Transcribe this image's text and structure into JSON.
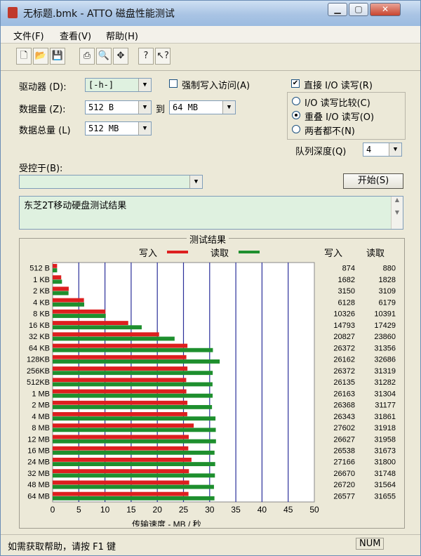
{
  "window": {
    "title": "无标题.bmk - ATTO 磁盘性能测试"
  },
  "menu": [
    "文件(F)",
    "查看(V)",
    "帮助(H)"
  ],
  "toolbar": [
    {
      "icon": "new-file-icon",
      "glyph": "🗋"
    },
    {
      "icon": "open-folder-icon",
      "glyph": "📂"
    },
    {
      "icon": "save-icon",
      "glyph": "💾"
    },
    {
      "icon": "print-icon",
      "glyph": "⎙"
    },
    {
      "icon": "print-preview-icon",
      "glyph": "🔍"
    },
    {
      "icon": "move-icon",
      "glyph": "✥"
    },
    {
      "icon": "help-icon",
      "glyph": "?"
    },
    {
      "icon": "context-help-icon",
      "glyph": "↖?"
    }
  ],
  "settings": {
    "drive_label": "驱动器 (D):",
    "drive_value": "[-h-]",
    "force_write_label": "强制写入访问(A)",
    "direct_io_label": "直接 I/O 读写(R)",
    "transfer_label": "数据量 (Z):",
    "transfer_from": "512 B",
    "to_label": "到",
    "transfer_to": "64 MB",
    "total_label": "数据总量 (L)",
    "total_value": "512 MB",
    "radio_1": "I/O 读写比较(C)",
    "radio_2": "重叠 I/O 读写(O)",
    "radio_3": "两者都不(N)",
    "queue_label": "队列深度(Q)",
    "queue_value": "4",
    "controlled_label": "受控于(B):",
    "controlled_value": "",
    "start_button": "开始(S)",
    "description": "东芝2T移动硬盘测试结果"
  },
  "results": {
    "title": "测试结果",
    "legend_write": "写入",
    "legend_read": "读取",
    "col_write": "写入",
    "col_read": "读取",
    "xlabel": "传输速度  -  MB / 秒",
    "colors": {
      "write": "#dd1f1f",
      "read": "#1e8f2e",
      "grid": "#2a2f9a"
    }
  },
  "chart_data": {
    "type": "bar",
    "orientation": "horizontal",
    "title": "测试结果",
    "xlabel": "传输速度  -  MB / 秒",
    "xlim": [
      0,
      50
    ],
    "xticks": [
      0,
      5,
      10,
      15,
      20,
      25,
      30,
      35,
      40,
      45,
      50
    ],
    "categories": [
      "512 B",
      "1 KB",
      "2 KB",
      "4 KB",
      "8 KB",
      "16 KB",
      "32 KB",
      "64 KB",
      "128KB",
      "256KB",
      "512KB",
      "1 MB",
      "2 MB",
      "4 MB",
      "8 MB",
      "12 MB",
      "16 MB",
      "24 MB",
      "32 MB",
      "48 MB",
      "64 MB"
    ],
    "series": [
      {
        "name": "写入",
        "values": [
          874,
          1682,
          3150,
          6128,
          10326,
          14793,
          20827,
          26372,
          26162,
          26372,
          26135,
          26163,
          26368,
          26343,
          27602,
          26627,
          26538,
          27166,
          26670,
          26720,
          26577
        ]
      },
      {
        "name": "读取",
        "values": [
          880,
          1828,
          3109,
          6179,
          10391,
          17429,
          23860,
          31356,
          32686,
          31319,
          31282,
          31304,
          31177,
          31861,
          31918,
          31958,
          31673,
          31800,
          31748,
          31564,
          31655
        ]
      }
    ]
  },
  "status": {
    "hint": "如需获取帮助，请按 F1 键",
    "num": "NUM"
  }
}
